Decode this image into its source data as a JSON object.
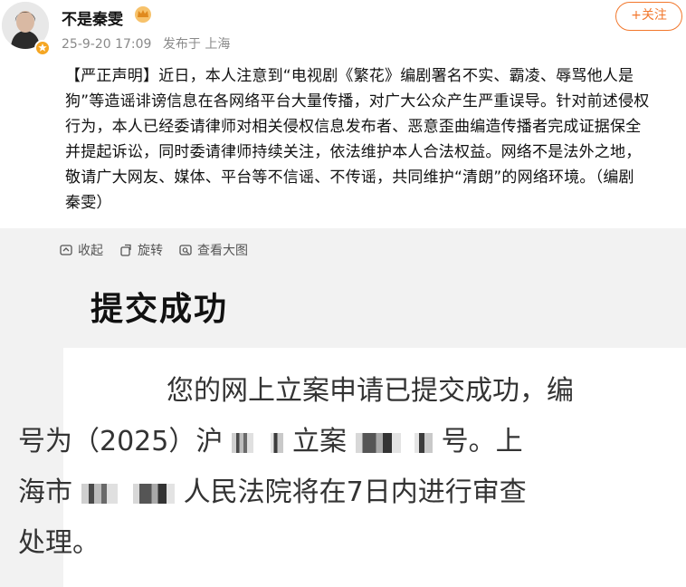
{
  "user": {
    "name": "不是秦雯",
    "timestamp": "25-9-20 17:09",
    "source": "发布于 上海"
  },
  "follow_button": {
    "label": "+关注"
  },
  "post": {
    "text_lines": [
      "【严正声明】近日，本人注意到“电视剧《繁花》编剧署名不实、霸凌、辱骂他人是",
      "狗”等造谣诽谤信息在各网络平台大量传播，对广大公众产生严重误导。针对前述侵权",
      "行为，本人已经委请律师对相关侵权信息发布者、恶意歪曲编造传播者完成证据保全",
      "并提起诉讼，同时委请律师持续关注，依法维护本人合法权益。网络不是法外之地，",
      "敬请广大网友、媒体、平台等不信谣、不传谣，共同维护“清朗”的网络环境。（编剧",
      "秦雯）"
    ]
  },
  "image_toolbar": {
    "collapse_label": "收起",
    "rotate_label": "旋转",
    "view_large_label": "查看大图"
  },
  "screenshot": {
    "title": "提交成功",
    "line1": "您的网上立案申请已提交成功，编",
    "line2_a": "号为（2025）沪",
    "line2_b": "立案",
    "line2_c": "号。上",
    "line3_a": "海市",
    "line3_b": "人民法院将在7日内进行审查",
    "line4": "处理。"
  },
  "colors": {
    "accent": "#f2772c",
    "meta_gray": "#8a8a8a",
    "image_bg": "#f2f2f2"
  }
}
